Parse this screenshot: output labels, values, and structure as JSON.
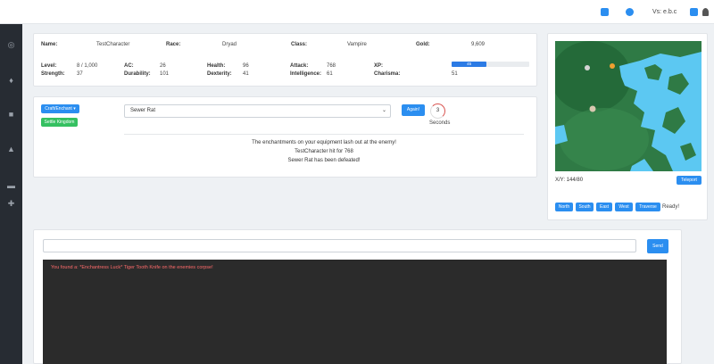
{
  "header": {
    "version": "Vs: e.b.c",
    "icons": [
      "notification-icon",
      "github-icon",
      "chat-icon",
      "user-icon"
    ]
  },
  "sidebar": {
    "icons": [
      "ring-icon",
      "potion-icon",
      "armor-icon",
      "boot-icon",
      "anvil-icon",
      "puzzle-icon"
    ]
  },
  "character": {
    "name_label": "Name:",
    "name": "TestCharacter",
    "race_label": "Race:",
    "race": "Dryad",
    "class_label": "Class:",
    "class": "Vampire",
    "gold_label": "Gold:",
    "gold": "9,609",
    "level_label": "Level:",
    "level": "8 / 1,000",
    "ac_label": "AC:",
    "ac": "26",
    "health_label": "Health:",
    "health": "96",
    "attack_label": "Attack:",
    "attack": "768",
    "xp_label": "XP:",
    "xp": "45",
    "xp_fraction": 0.45,
    "strength_label": "Strength:",
    "strength": "37",
    "durability_label": "Durability:",
    "durability": "101",
    "dexterity_label": "Dexterity:",
    "dexterity": "41",
    "intelligence_label": "Intelligence:",
    "intelligence": "61",
    "charisma_label": "Charisma:",
    "charisma": "51"
  },
  "combat": {
    "craft_button": "Craft/Enchant",
    "kingdom_button": "Settle Kingdom",
    "monster_selected": "Sewer Rat",
    "attack_button": "Again!",
    "timer_value": "3",
    "timer_label": "Seconds",
    "messages": [
      "The enchantments on your equipment lash out at the enemy!",
      "TestCharacter hit for 768",
      "Sewer Rat has been defeated!"
    ]
  },
  "map": {
    "coordinates": "X/Y: 144/80",
    "teleport_button": "Teleport",
    "directions": [
      "North",
      "South",
      "East",
      "West",
      "Traverse"
    ],
    "status": "Ready!"
  },
  "chat": {
    "input_value": "",
    "send_button": "Send",
    "messages": [
      "You found a: *Enchantress Luck* Tiger Tooth Knife on the enemies corpse!"
    ]
  },
  "colors": {
    "accent": "#2b8ef0",
    "success": "#35c061",
    "sidebar": "#272c33",
    "console_bg": "#2b2b2b",
    "console_text": "#ff6b6b",
    "map_land": "#2f7a45",
    "map_water": "#5cc8f2"
  }
}
